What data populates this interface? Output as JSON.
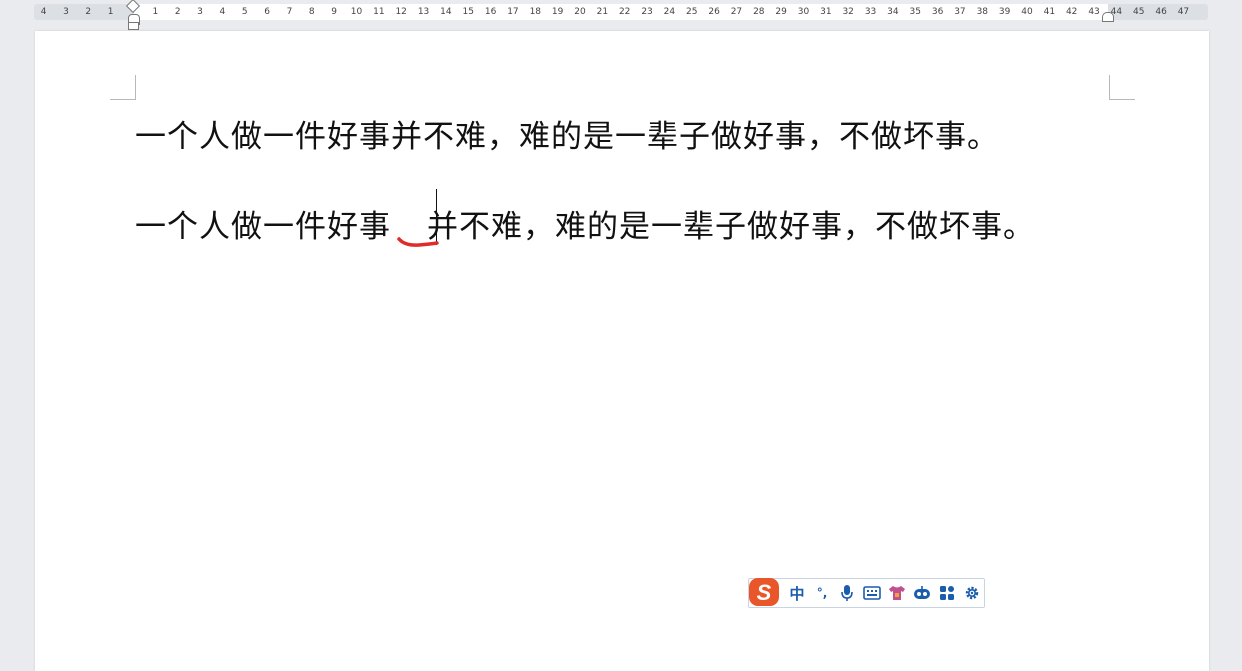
{
  "ruler": {
    "left_ticks": [
      "4",
      "3",
      "2",
      "1"
    ],
    "right_ticks": [
      "1",
      "2",
      "3",
      "4",
      "5",
      "6",
      "7",
      "8",
      "9",
      "10",
      "11",
      "12",
      "13",
      "14",
      "15",
      "16",
      "17",
      "18",
      "19",
      "20",
      "21",
      "22",
      "23",
      "24",
      "25",
      "26",
      "27",
      "28",
      "29",
      "30",
      "31",
      "32",
      "33",
      "34",
      "35",
      "36",
      "37",
      "38",
      "39",
      "40",
      "41",
      "42",
      "43",
      "44",
      "45",
      "46",
      "47"
    ]
  },
  "document": {
    "line1": "一个人做一件好事并不难，难的是一辈子做好事，不做坏事。",
    "line2_before": "一个人做一件好事",
    "line2_after": "并不难，难的是一辈子做好事，不做坏事。"
  },
  "ime": {
    "logo_icon": "sogou-logo-icon",
    "lang_label": "中",
    "punct_label": "°,",
    "items": [
      "microphone-icon",
      "keyboard-icon",
      "skin-shirt-icon",
      "robot-icon",
      "apps-grid-icon",
      "settings-gear-icon"
    ],
    "accent_color": "#1a5cad",
    "logo_color": "#e8562a"
  },
  "annotation": {
    "red_mark_color": "#e02b2b"
  }
}
